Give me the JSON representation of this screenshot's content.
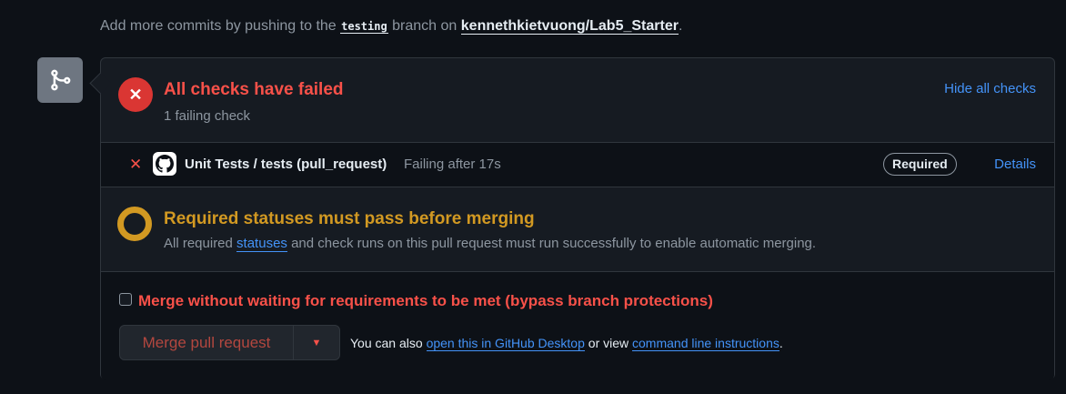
{
  "hint": {
    "prefix": "Add more commits by pushing to the ",
    "branch": "testing",
    "middle": " branch on ",
    "repo": "kennethkietvuong/Lab5_Starter",
    "suffix": "."
  },
  "checks": {
    "title": "All checks have failed",
    "subtitle": "1 failing check",
    "hide_label": "Hide all checks",
    "row": {
      "name": "Unit Tests / tests (pull_request)",
      "status": "Failing after 17s",
      "badge": "Required",
      "details_label": "Details"
    }
  },
  "requirements": {
    "title": "Required statuses must pass before merging",
    "desc_prefix": "All required ",
    "desc_link": "statuses",
    "desc_suffix": " and check runs on this pull request must run successfully to enable automatic merging."
  },
  "merge": {
    "bypass_label": "Merge without waiting for requirements to be met (bypass branch protections)",
    "button_label": "Merge pull request",
    "alt_prefix": "You can also ",
    "desktop_link": "open this in GitHub Desktop",
    "alt_middle": " or view ",
    "cli_link": "command line instructions",
    "alt_suffix": "."
  },
  "colors": {
    "background": "#0d1117",
    "danger": "#f85149",
    "warning": "#d29922",
    "link": "#4493f8"
  },
  "icons": [
    "git-merge-icon",
    "x-circle-icon",
    "x-icon",
    "github-icon",
    "pending-ring-icon",
    "caret-down-icon"
  ]
}
